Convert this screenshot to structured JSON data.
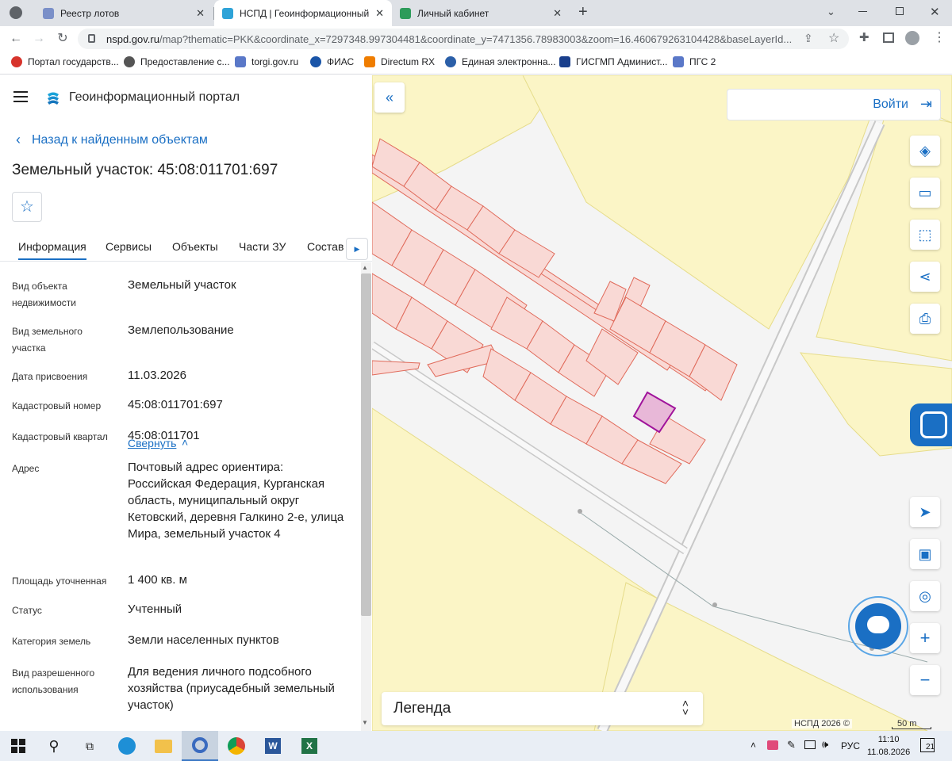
{
  "browser": {
    "tabs": [
      {
        "title": "Реестр лотов",
        "active": false
      },
      {
        "title": "НСПД | Геоинформационный п",
        "active": true
      },
      {
        "title": "Личный кабинет",
        "active": false
      }
    ],
    "new_tab": "+",
    "url_host": "nspd.gov.ru",
    "url_rest": "/map?thematic=PKK&coordinate_x=7297348.997304481&coordinate_y=7471356.78983003&zoom=16.460679263104428&baseLayerId...",
    "bookmarks": [
      {
        "label": "Портал государств...",
        "color": "#d7342c"
      },
      {
        "label": "Предоставление с...",
        "color": "#555555"
      },
      {
        "label": "torgi.gov.ru",
        "color": "#5a78c8"
      },
      {
        "label": "ФИАС",
        "color": "#1a55a8"
      },
      {
        "label": "Directum RX",
        "color": "#ef7d00"
      },
      {
        "label": "Единая электронна...",
        "color": "#2b5fa8"
      },
      {
        "label": "ГИСГМП Админист...",
        "color": "#1a3f8c"
      },
      {
        "label": "ПГС 2",
        "color": "#5a78c8"
      }
    ]
  },
  "panel": {
    "portal_title": "Геоинформационный портал",
    "back_label": "Назад к найденным объектам",
    "object_title": "Земельный участок: 45:08:011701:697",
    "tabs": [
      "Информация",
      "Сервисы",
      "Объекты",
      "Части ЗУ",
      "Состав"
    ],
    "rows": [
      {
        "label": "Вид объекта недвижимости",
        "value": "Земельный участок"
      },
      {
        "label": "Вид земельного участка",
        "value": "Землепользование"
      },
      {
        "label": "Дата присвоения",
        "value": "11.03.2026"
      },
      {
        "label": "Кадастровый номер",
        "value": "45:08:011701:697"
      },
      {
        "label": "Кадастровый квартал",
        "value": "45:08:011701"
      },
      {
        "label": "Адрес",
        "value": "Почтовый адрес ориентира: Российская Федерация, Курганская область, муниципальный округ Кетовский, деревня Галкино 2-е, улица Мира, земельный участок 4"
      },
      {
        "label": "Площадь уточненная",
        "value": "1 400 кв. м"
      },
      {
        "label": "Статус",
        "value": "Учтенный"
      },
      {
        "label": "Категория земель",
        "value": "Земли населенных пунктов"
      },
      {
        "label": "Вид разрешенного использования",
        "value": "Для ведения личного подсобного хозяйства (приусадебный земельный участок)"
      }
    ],
    "collapse_label": "Свернуть"
  },
  "map": {
    "login_label": "Войти",
    "legend_label": "Легенда",
    "copyright": "НСПД 2026 ©",
    "scale_label": "50 m",
    "colors": {
      "parcel_fill": "#f9d9d5",
      "parcel_stroke": "#e06a5a",
      "zone_fill": "#fbf5c6",
      "selected_stroke": "#a0139b",
      "accent": "#1a6fc4"
    },
    "controls": [
      "collapse-panel-icon",
      "layers-icon",
      "ruler-icon",
      "select-area-icon",
      "share-icon",
      "print-icon",
      "locate-icon",
      "minimap-icon",
      "search-point-icon",
      "zoom-in-icon",
      "zoom-out-icon"
    ]
  },
  "taskbar": {
    "apps": [
      "windows-start",
      "search",
      "task-view",
      "edge",
      "explorer",
      "tile-app",
      "chrome",
      "word",
      "excel"
    ],
    "lang": "РУС",
    "time": "11:10",
    "date": "11.08.2026",
    "notifications": "21"
  }
}
